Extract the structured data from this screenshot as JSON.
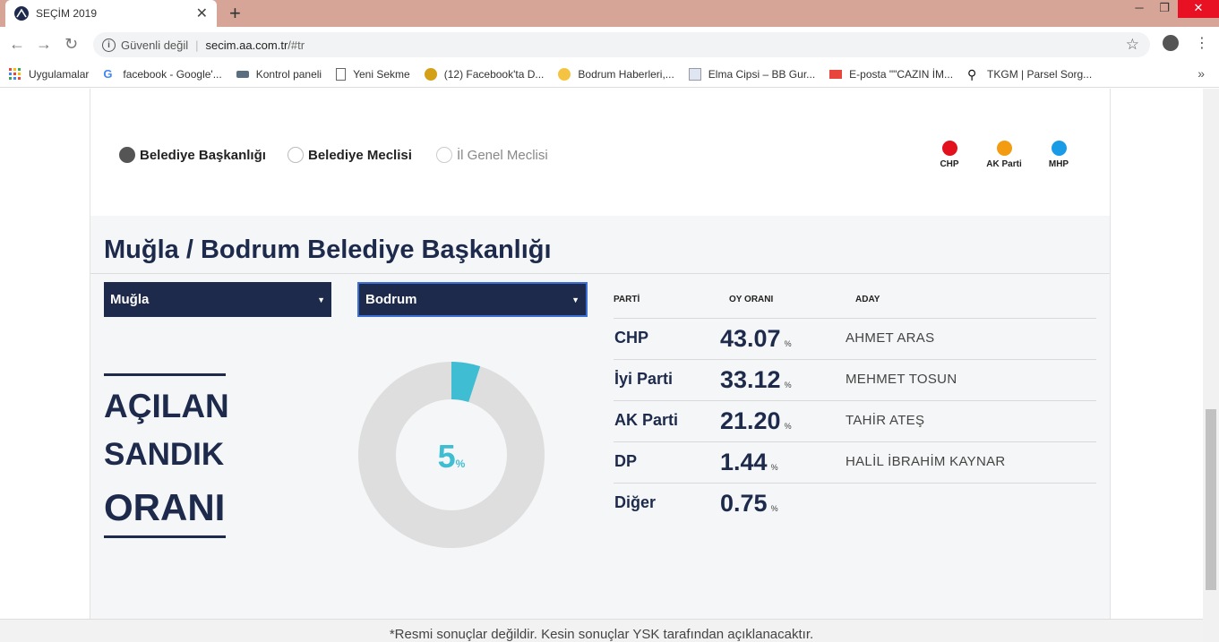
{
  "browser": {
    "tab_title": "SEÇİM 2019",
    "security_label": "Güvenli değil",
    "url_host": "secim.aa.com.tr",
    "url_path": "/#tr",
    "bookmarks": [
      "Uygulamalar",
      "facebook - Google'...",
      "Kontrol paneli",
      "Yeni Sekme",
      "(12) Facebook'ta D...",
      "Bodrum Haberleri,...",
      "Elma Cipsi – BB Gur...",
      "E-posta \"\"CAZIN İM...",
      "TKGM | Parsel Sorg..."
    ]
  },
  "election_type": {
    "options": [
      "Belediye Başkanlığı",
      "Belediye Meclisi",
      "İl Genel Meclisi"
    ],
    "selected": "Belediye Başkanlığı"
  },
  "legend": [
    {
      "label": "CHP",
      "color": "#e3101d"
    },
    {
      "label": "AK Parti",
      "color": "#f39c12"
    },
    {
      "label": "MHP",
      "color": "#1a9be6"
    }
  ],
  "heading": "Muğla / Bodrum Belediye Başkanlığı",
  "filters": {
    "province": "Muğla",
    "district": "Bodrum"
  },
  "opened_boxes": {
    "lines": [
      "AÇILAN",
      "SANDIK",
      "ORANI"
    ],
    "value": "5",
    "unit": "%",
    "fraction": 0.05
  },
  "results": {
    "headers": {
      "party": "PARTİ",
      "vote": "OY ORANI",
      "candidate": "ADAY"
    },
    "unit": "%",
    "rows": [
      {
        "party": "CHP",
        "vote": "43.07",
        "candidate": "AHMET ARAS"
      },
      {
        "party": "İyi Parti",
        "vote": "33.12",
        "candidate": "MEHMET TOSUN"
      },
      {
        "party": "AK Parti",
        "vote": "21.20",
        "candidate": "TAHİR ATEŞ"
      },
      {
        "party": "DP",
        "vote": "1.44",
        "candidate": "HALİL İBRAHİM KAYNAR"
      },
      {
        "party": "Diğer",
        "vote": "0.75",
        "candidate": ""
      }
    ]
  },
  "footer_note": "*Resmi sonuçlar değildir. Kesin sonuçlar YSK tarafından açıklanacaktır.",
  "colors": {
    "navy": "#1d2a4b",
    "donut_fill": "#3fbdd3",
    "donut_track": "#dedede"
  }
}
